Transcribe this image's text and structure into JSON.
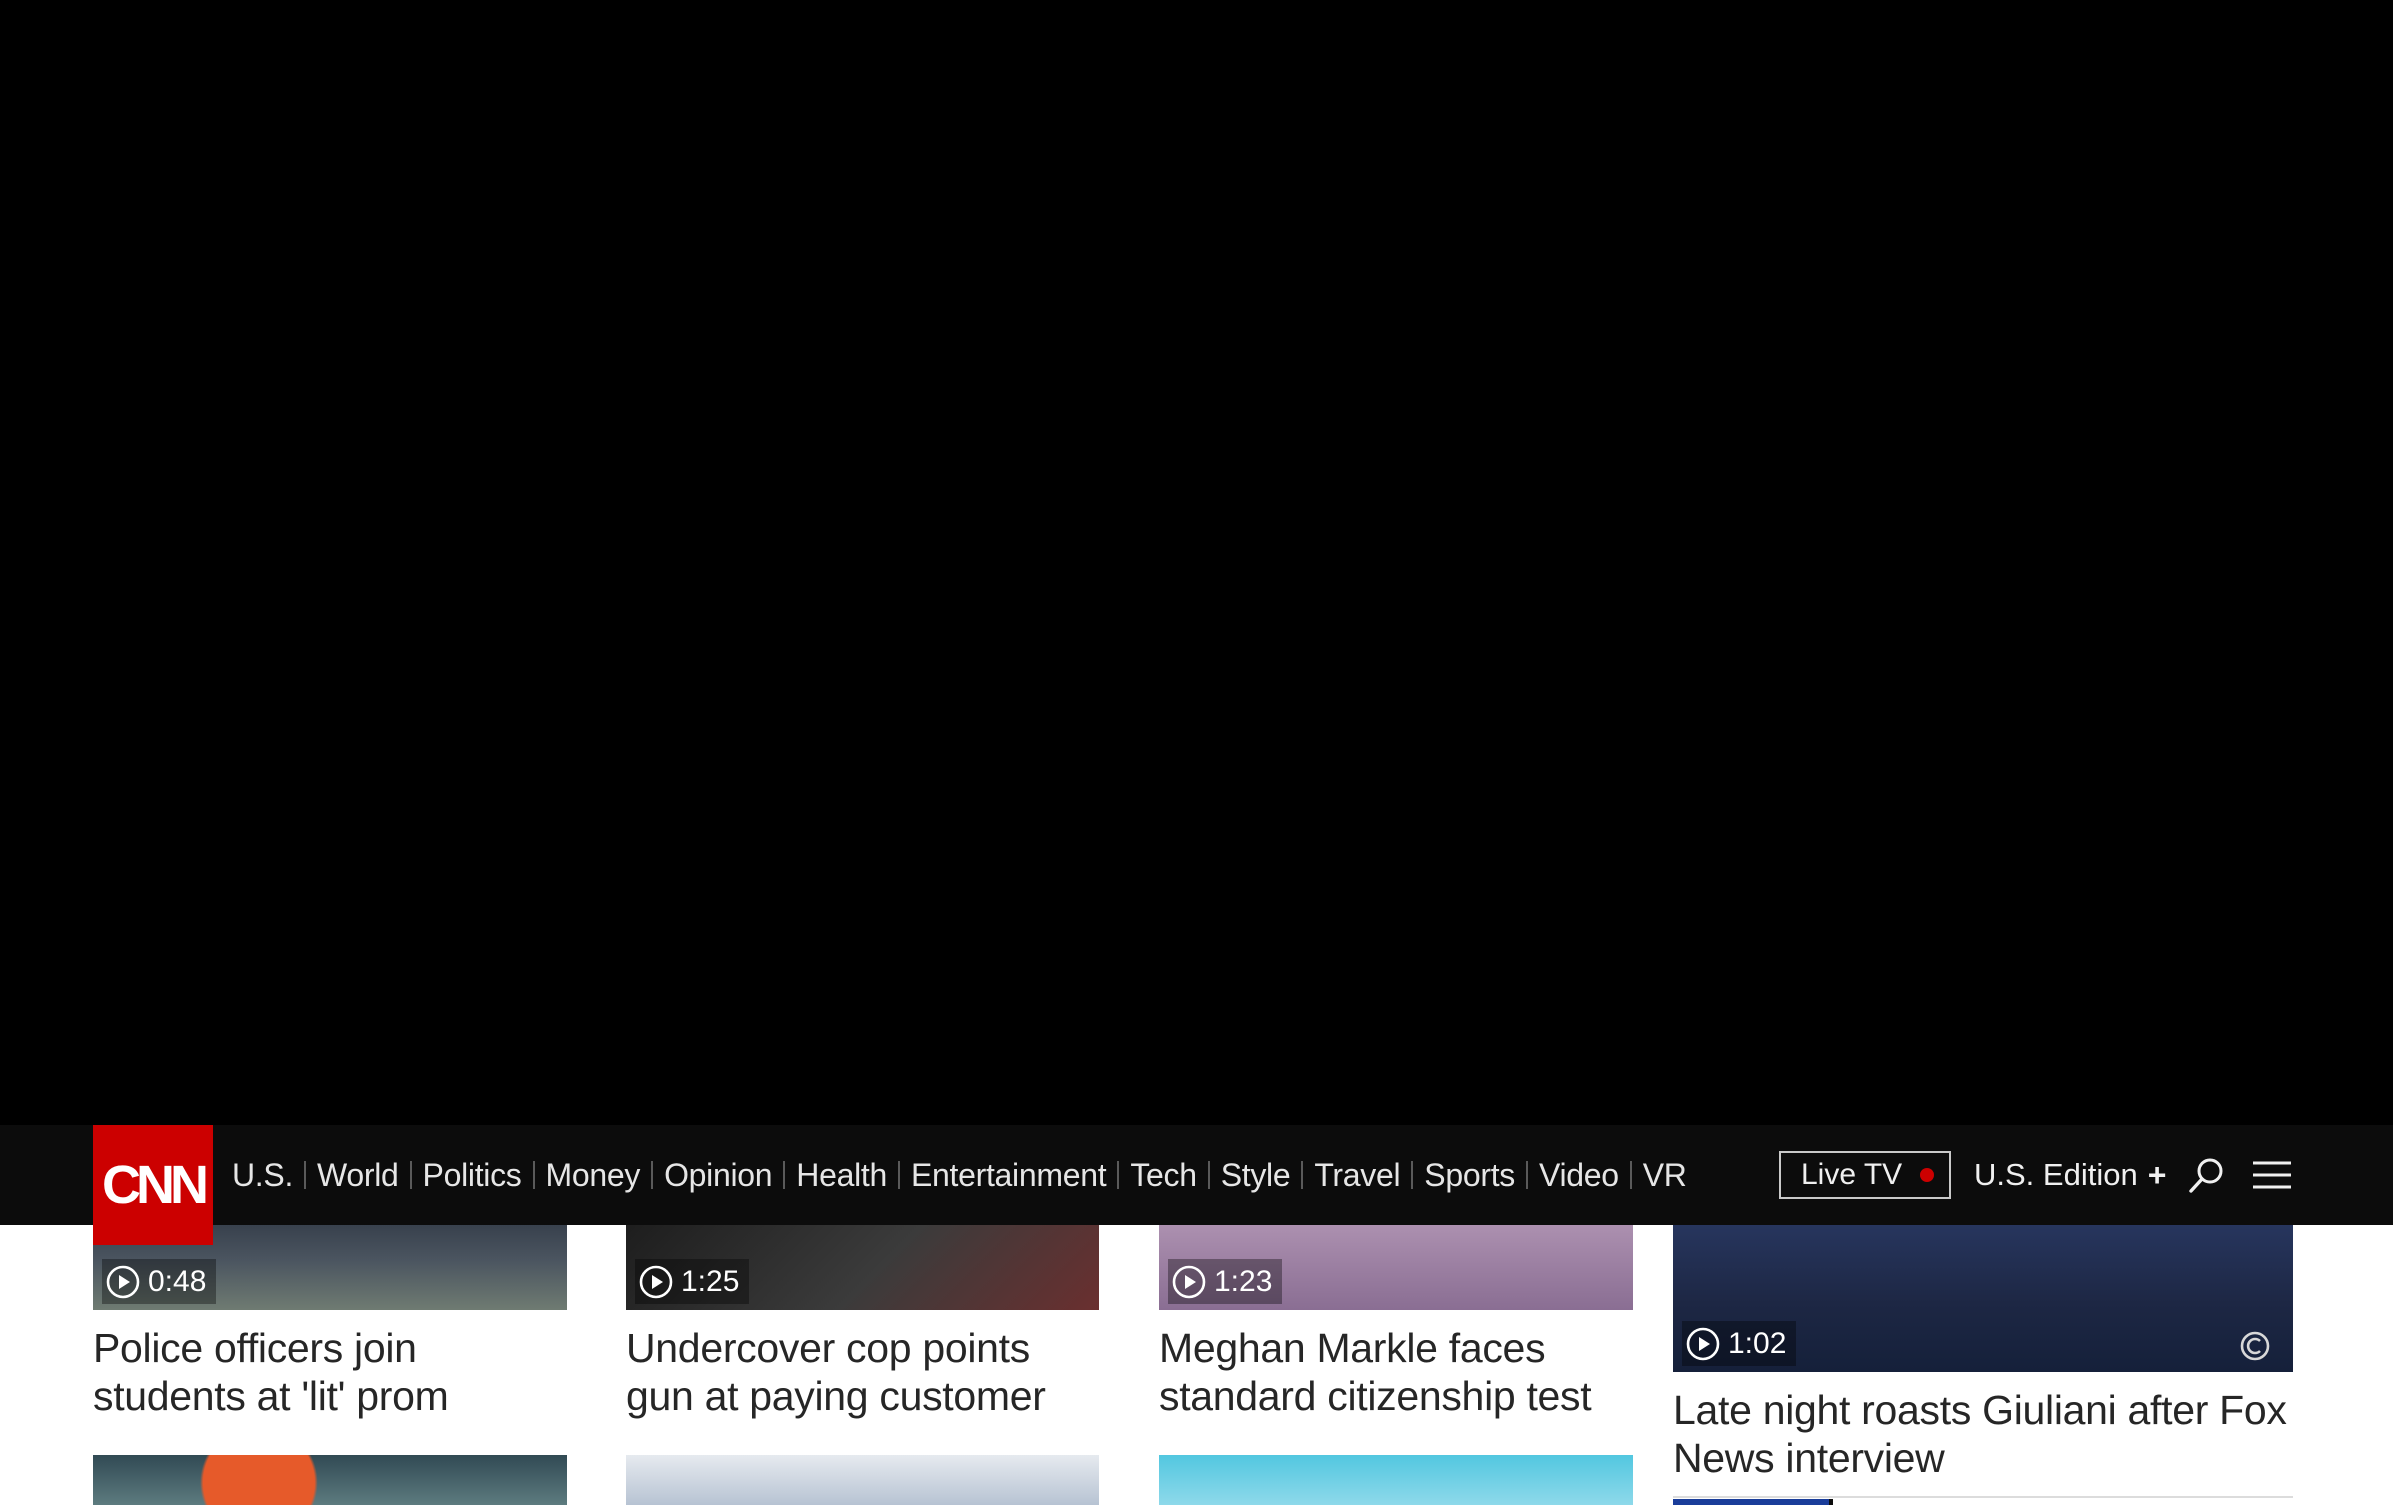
{
  "nav": {
    "logo": "CNN",
    "links": [
      "U.S.",
      "World",
      "Politics",
      "Money",
      "Opinion",
      "Health",
      "Entertainment",
      "Tech",
      "Style",
      "Travel",
      "Sports",
      "Video",
      "VR"
    ],
    "live_tv": "Live TV",
    "edition": "U.S. Edition",
    "icons": [
      "search-icon",
      "menu-icon",
      "plus-icon"
    ]
  },
  "cards": [
    {
      "duration": "0:48",
      "headline": "Police officers join students at 'lit' prom"
    },
    {
      "duration": "1:25",
      "headline": "Undercover cop points gun at paying customer"
    },
    {
      "duration": "1:23",
      "headline": "Meghan Markle faces standard citizenship test"
    },
    {
      "duration": "1:02",
      "headline": "Late night roasts Giuliani after Fox News interview"
    }
  ],
  "colors": {
    "brand_red": "#cc0000",
    "nav_bg": "#0c0c0c",
    "headline": "#262626"
  }
}
